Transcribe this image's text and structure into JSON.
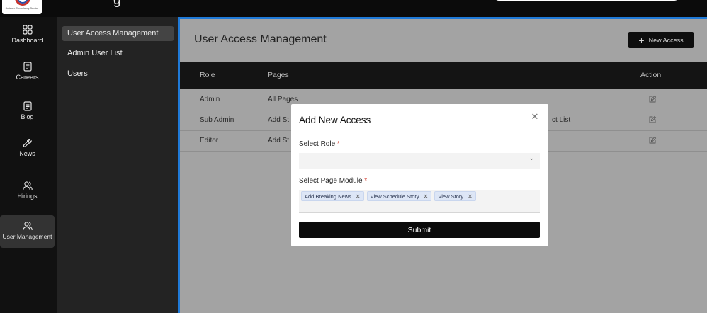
{
  "colors": {
    "accent": "#1f7ad8",
    "rail_bg": "#111111",
    "subbar_bg": "#232323",
    "overlay_bg": "#a3a3a3",
    "required": "#d23a2c",
    "tag_bg": "#dde6f6"
  },
  "topbar": {
    "logo_text": "Software Consultancy Service",
    "title_fragment": "g"
  },
  "rail": [
    {
      "label": "Dashboard",
      "icon": "grid-icon"
    },
    {
      "label": "Careers",
      "icon": "document-icon"
    },
    {
      "label": "Blog",
      "icon": "document-icon"
    },
    {
      "label": "News",
      "icon": "wrench-icon"
    },
    {
      "label": "Hirings",
      "icon": "users-icon"
    },
    {
      "label": "User Management",
      "icon": "users-icon"
    }
  ],
  "sub": [
    {
      "label": "User Access Management"
    },
    {
      "label": "Admin User List"
    },
    {
      "label": "Users"
    }
  ],
  "main": {
    "title": "User Access Management",
    "new_button": "New Access",
    "columns": [
      "Role",
      "Pages",
      "Action"
    ],
    "rows": [
      {
        "role": "Admin",
        "pages": "All Pages"
      },
      {
        "role": "Sub Admin",
        "pages": "Add St",
        "pages_tail": "ct List"
      },
      {
        "role": "Editor",
        "pages": "Add St"
      }
    ]
  },
  "modal": {
    "title": "Add New Access",
    "role_label": "Select Role",
    "role_value": "",
    "module_label": "Select Page Module",
    "required_mark": "*",
    "tags": [
      "Add Breaking News",
      "View Schedule Story",
      "View Story"
    ],
    "submit": "Submit"
  }
}
